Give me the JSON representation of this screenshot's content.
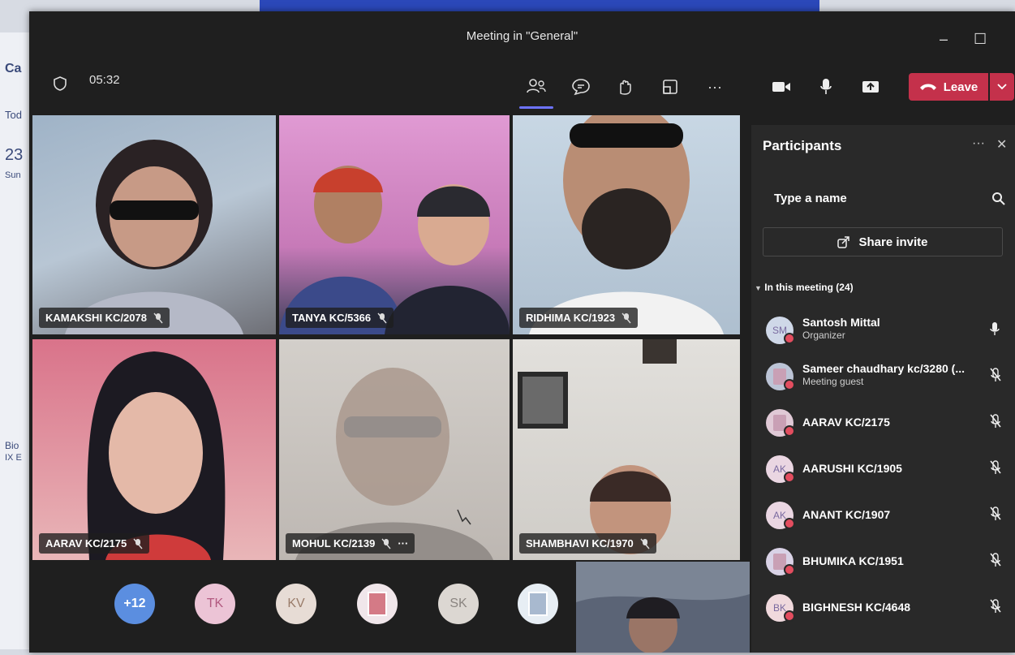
{
  "background": {
    "side_letters": [
      "Ca",
      "Tod",
      "23",
      "Sun",
      "Bio",
      "IX E"
    ]
  },
  "window": {
    "title": "Meeting in \"General\"",
    "minimize": "–",
    "maximize": "☐"
  },
  "toolbar": {
    "timer": "05:32",
    "leave_label": "Leave",
    "buttons": [
      "participants",
      "chat",
      "react",
      "view",
      "more",
      "camera",
      "mic",
      "share"
    ]
  },
  "tiles": [
    {
      "name": "KAMAKSHI KC/2078",
      "bg": "#a8b8c8"
    },
    {
      "name": "TANYA KC/5366",
      "bg": "#d18cc0"
    },
    {
      "name": "RIDHIMA KC/1923",
      "bg": "#b9c9d8"
    },
    {
      "name": "AARAV KC/2175",
      "bg": "#c87a8e"
    },
    {
      "name": "MOHUL KC/2139",
      "bg": "#c7c3be",
      "extra": "···"
    },
    {
      "name": "SHAMBHAVI KC/1970",
      "bg": "#d8d6d2"
    }
  ],
  "strip": {
    "overflow": "+12",
    "bubbles": [
      "TK",
      "KV",
      "",
      "SK",
      ""
    ]
  },
  "panel": {
    "title": "Participants",
    "more": "···",
    "close": "✕",
    "search_placeholder": "Type a name",
    "share_invite": "Share invite",
    "section": "In this meeting (24)",
    "participants": [
      {
        "initials": "SM",
        "name": "Santosh Mittal",
        "role": "Organizer",
        "mic": "on",
        "avatar_color": "#cfd8e8"
      },
      {
        "initials": "",
        "name": "Sameer chaudhary kc/3280 (...",
        "role": "Meeting guest",
        "mic": "off",
        "avatar_color": "#bcc4d6"
      },
      {
        "initials": "",
        "name": "AARAV KC/2175",
        "role": "",
        "mic": "off",
        "avatar_color": "#e0c9d6"
      },
      {
        "initials": "AK",
        "name": "AARUSHI KC/1905",
        "role": "",
        "mic": "off",
        "avatar_color": "#ead6e2"
      },
      {
        "initials": "AK",
        "name": "ANANT KC/1907",
        "role": "",
        "mic": "off",
        "avatar_color": "#ead6e2"
      },
      {
        "initials": "",
        "name": "BHUMIKA KC/1951",
        "role": "",
        "mic": "off",
        "avatar_color": "#d9d2e6"
      },
      {
        "initials": "BK",
        "name": "BIGHNESH KC/4648",
        "role": "",
        "mic": "off",
        "avatar_color": "#f0d9dd"
      }
    ]
  }
}
